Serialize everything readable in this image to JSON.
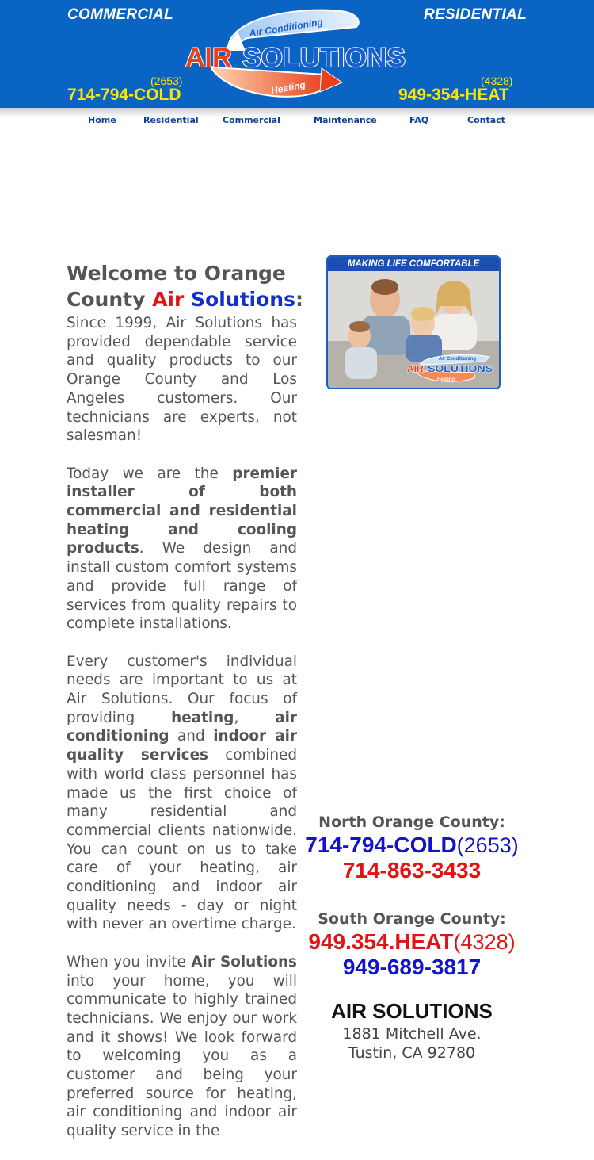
{
  "header": {
    "left_tag": "COMMERCIAL",
    "right_tag": "RESIDENTIAL",
    "left_phone_word": "714-794-COLD",
    "left_phone_num": "(2653)",
    "right_phone_word": "949-354-HEAT",
    "right_phone_num": "(4328)",
    "logo_air": "AIR",
    "logo_solutions": "SOLUTIONS",
    "logo_arc_top": "Air Conditioning",
    "logo_arc_bottom": "Heating",
    "colors": {
      "background": "#0a64c4",
      "phone": "#ffe600",
      "logo_red": "#e8401c",
      "logo_blue": "#1a5fd0"
    }
  },
  "nav": {
    "home": "Home",
    "residential": "Residential",
    "commercial": "Commercial",
    "maintenance": "Maintenance",
    "faq": "FAQ",
    "contact": "Contact"
  },
  "welcome": {
    "line1": "Welcome to Orange",
    "line2_pre": "County ",
    "air": "Air",
    "solutions": "Solutions",
    "colon": ":"
  },
  "body": {
    "p1": "Since 1999, Air Solutions has provided dependable service and quality products to our Orange County and Los Angeles customers. Our technicians are experts, not salesman!",
    "p2_pre": "Today we are the ",
    "p2_bold": "premier installer of both commercial and residential heating and cooling products",
    "p2_post": ". We design and install custom comfort systems and provide full range of services from quality repairs to complete installations.",
    "p3_pre": "Every customer's individual needs are important to us at Air Solutions. Our focus of providing ",
    "p3_b1": "heating",
    "p3_sep": ", ",
    "p3_b2": "air conditioning",
    "p3_and": " and ",
    "p3_b3": "indoor air quality services",
    "p3_post": " combined with world class personnel has made us the first choice of many residential and commercial clients nationwide. You can count on us to take care of your heating, air conditioning and indoor air quality needs - day or night with never an overtime charge.",
    "p4_pre": "When you invite ",
    "p4_bold": "Air Solutions",
    "p4_post": " into your home, you will communicate to highly trained technicians. We enjoy our work and it shows! We look forward to welcoming you as a customer and being your preferred source for heating, air conditioning and indoor air quality service in the"
  },
  "photo": {
    "banner": "MAKING LIFE COMFORTABLE",
    "logo_air": "AIR",
    "logo_solutions": "SOLUTIONS",
    "arc_top": "Air Conditioning",
    "arc_bottom": "Heating"
  },
  "contact": {
    "north_label": "North Orange County:",
    "north_word": "714-794-COLD",
    "north_num": "(2653)",
    "north_alt": "714-863-3433",
    "south_label": "South Orange County:",
    "south_word": "949.354.HEAT",
    "south_num": "(4328)",
    "south_alt": "949-689-3817",
    "company": "AIR SOLUTIONS",
    "street": "1881 Mitchell Ave.",
    "city": "Tustin, CA 92780"
  }
}
